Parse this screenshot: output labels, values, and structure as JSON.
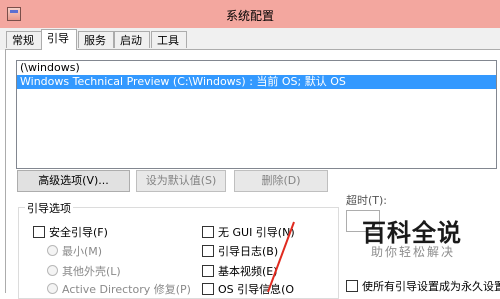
{
  "window": {
    "title": "系统配置"
  },
  "tabs": [
    {
      "label": "常规"
    },
    {
      "label": "引导"
    },
    {
      "label": "服务"
    },
    {
      "label": "启动"
    },
    {
      "label": "工具"
    }
  ],
  "os_list": [
    {
      "label": "(\\windows)"
    },
    {
      "label": "Windows Technical Preview (C:\\Windows) : 当前 OS; 默认 OS",
      "selected": true
    }
  ],
  "buttons": {
    "advanced": "高级选项(V)...",
    "set_default": "设为默认值(S)",
    "delete": "删除(D)"
  },
  "boot_options": {
    "title": "引导选项",
    "safe_boot": "安全引导(F)",
    "minimal": "最小(M)",
    "alternate_shell": "其他外壳(L)",
    "ad_repair": "Active Directory 修复(P)",
    "no_gui": "无 GUI 引导(N)",
    "boot_log": "引导日志(B)",
    "base_video": "基本视频(E)",
    "os_boot_info": "OS 引导信息(O"
  },
  "timeout": {
    "label": "超时(T):"
  },
  "make_permanent": {
    "label": "使所有引导设置成为永久设置"
  },
  "watermark": {
    "text": "百科全说",
    "sub": "助你轻松解决"
  }
}
